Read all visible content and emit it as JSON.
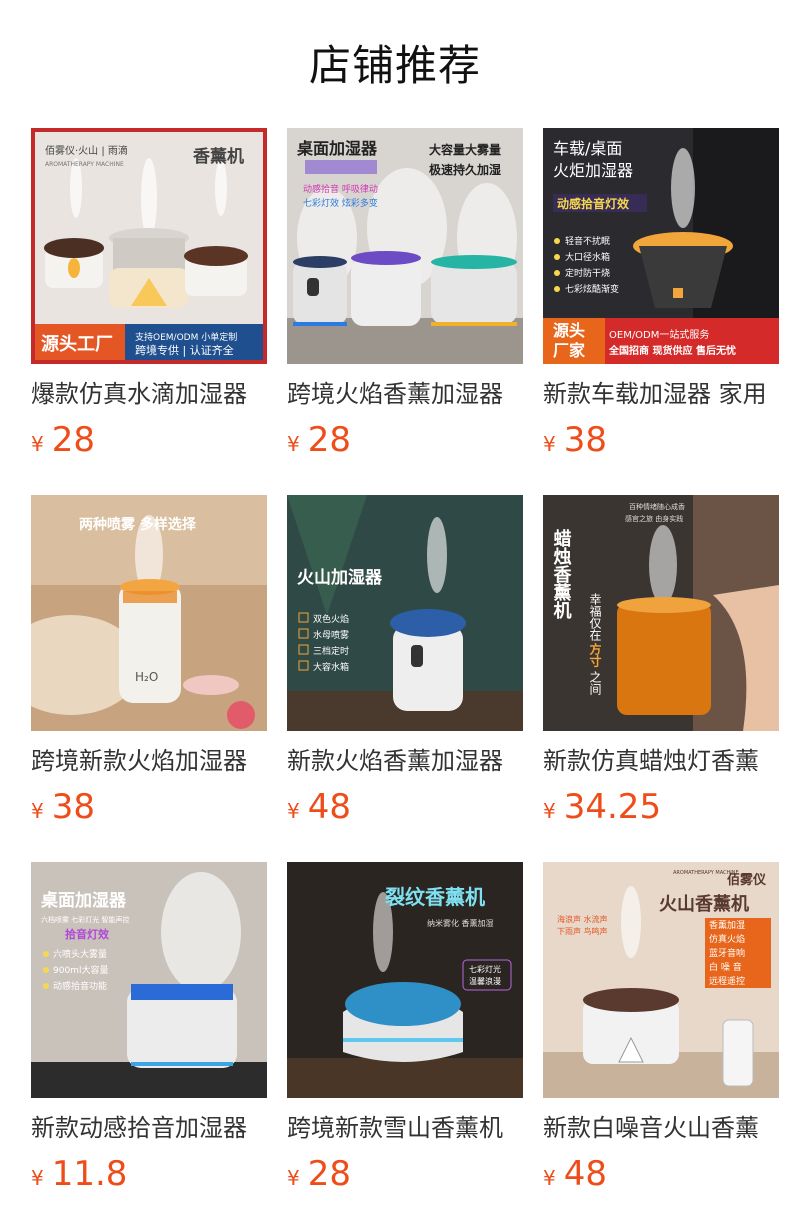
{
  "section": {
    "title": "店铺推荐"
  },
  "currency_symbol": "¥",
  "products": [
    {
      "title": "爆款仿真水滴加湿器",
      "price": "28",
      "image": {
        "brand_line": "佰雾仪·火山 | 雨滴",
        "brand_sub": "AROMATHERAPY MACHINE",
        "headline": "香薰机",
        "badge": "源头工厂",
        "footer_1": "支持OEM/ODM  小单定制",
        "footer_2": "跨境专供 | 认证齐全"
      }
    },
    {
      "title": "跨境火焰香薰加湿器",
      "price": "28",
      "image": {
        "headline": "桌面加湿器",
        "sub_1": "大容量大雾量",
        "sub_2": "极速持久加湿",
        "feature_1": "动感拾音 呼吸律动",
        "feature_2": "七彩灯效 炫彩多变"
      }
    },
    {
      "title": "新款车载加湿器 家用",
      "price": "38",
      "image": {
        "headline_1": "车载/桌面",
        "headline_2": "火炬加湿器",
        "feature": "动感拾音灯效",
        "bullets": [
          "轻音不扰眠",
          "大口径水箱",
          "定时防干烧",
          "七彩炫酷渐变"
        ],
        "badge_1": "源头",
        "badge_2": "厂家",
        "footer_1": "OEM/ODM一站式服务",
        "footer_2": "全国招商 现货供应 售后无忧"
      }
    },
    {
      "title": "跨境新款火焰加湿器",
      "price": "38",
      "image": {
        "headline": "两种喷雾 多样选择",
        "label": "H₂O"
      }
    },
    {
      "title": "新款火焰香薰加湿器",
      "price": "48",
      "image": {
        "headline": "火山加湿器",
        "bullets": [
          "双色火焰",
          "水母喷雾",
          "三档定时",
          "大容水箱"
        ]
      }
    },
    {
      "title": "新款仿真蜡烛灯香薰",
      "price": "34.25",
      "image": {
        "tagline": "百种情绪随心成香",
        "tagline_2": "感官之旅 由身实践",
        "vertical_1": "蜡烛香薰机",
        "vertical_2": "幸福仅在",
        "vertical_3": "方寸",
        "vertical_4": "之间"
      }
    },
    {
      "title": "新款动感拾音加湿器",
      "price": "11.8",
      "image": {
        "headline": "桌面加湿器",
        "sub": "六档喷雾  七彩灯光  智能声控",
        "feature": "拾音灯效",
        "bullets": [
          "六喷头大雾量",
          "900ml大容量",
          "动感拾音功能"
        ]
      }
    },
    {
      "title": "跨境新款雪山香薰机",
      "price": "28",
      "image": {
        "headline": "裂纹香薰机",
        "sub": "纳米雾化   香薰加湿",
        "badge_1": "七彩灯光",
        "badge_2": "温馨浪漫"
      }
    },
    {
      "title": "新款白噪音火山香薰",
      "price": "48",
      "image": {
        "brand": "佰雾仪",
        "brand_sub": "AROMATHERAPY MACHINE",
        "headline": "火山香薰机",
        "sounds_1": "海浪声  水流声",
        "sounds_2": "下雨声  鸟鸣声",
        "bullets": [
          "香薰加湿",
          "仿真火焰",
          "蓝牙音响",
          "白 噪 音",
          "远程遥控"
        ]
      }
    }
  ],
  "colors": {
    "price": "#ee4d1a",
    "title": "#333333"
  }
}
